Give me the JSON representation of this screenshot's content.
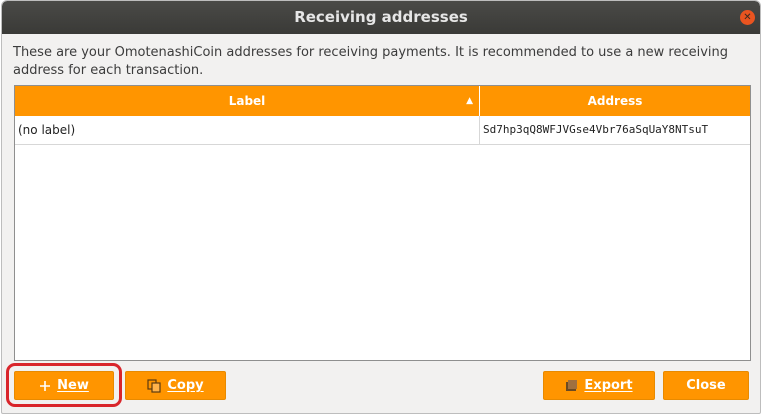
{
  "window": {
    "title": "Receiving addresses"
  },
  "description": "These are your OmotenashiCoin addresses for receiving payments. It is recommended to use a new receiving address for each transaction.",
  "table": {
    "columns": [
      "Label",
      "Address"
    ],
    "sort_indicator": "▲",
    "rows": [
      {
        "label": "(no label)",
        "address": "Sd7hp3qQ8WFJVGse4Vbr76aSqUaY8NTsuT"
      }
    ]
  },
  "buttons": {
    "new": "New",
    "copy": "Copy",
    "export": "Export",
    "close": "Close"
  },
  "icons": {
    "window_close": "close-icon",
    "new": "plus-icon",
    "copy": "copy-icon",
    "export": "export-icon"
  },
  "colors": {
    "accent": "#ff9500",
    "titlebar": "#3f3f3c",
    "highlight": "#d9252b"
  }
}
